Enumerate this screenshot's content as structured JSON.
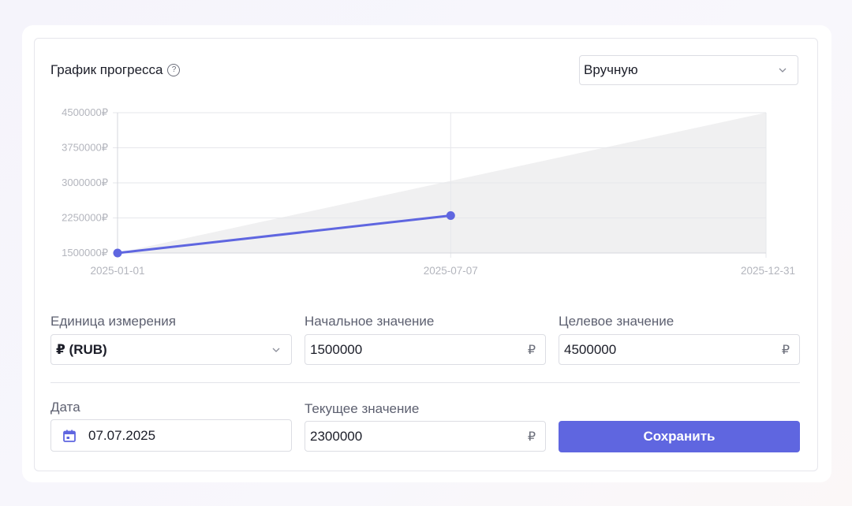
{
  "card": {
    "title": "График прогресса",
    "help_symbol": "?",
    "mode_select": {
      "value": "Вручную"
    }
  },
  "chart_data": {
    "type": "line",
    "x": [
      "2025-01-01",
      "2025-07-07"
    ],
    "series": [
      {
        "values": [
          1500000,
          2300000
        ]
      }
    ],
    "target_band": {
      "x": [
        "2025-01-01",
        "2025-12-31"
      ],
      "values": [
        1500000,
        4500000
      ]
    },
    "x_ticks": [
      "2025-01-01",
      "2025-07-07",
      "2025-12-31"
    ],
    "y_ticks": [
      "4500000₽",
      "3750000₽",
      "3000000₽",
      "2250000₽",
      "1500000₽"
    ],
    "ylim": [
      1500000,
      4500000
    ],
    "xlim": [
      "2025-01-01",
      "2025-12-31"
    ],
    "grid": true,
    "colors": {
      "line": "#5f66e0",
      "area": "#f0f0f1",
      "grid": "#e6e7eb"
    }
  },
  "form": {
    "unit": {
      "label": "Единица измерения",
      "value": "₽ (RUB)"
    },
    "start": {
      "label": "Начальное значение",
      "value": "1500000",
      "suffix": "₽"
    },
    "target": {
      "label": "Целевое значение",
      "value": "4500000",
      "suffix": "₽"
    },
    "date": {
      "label": "Дата",
      "value": "07.07.2025"
    },
    "current": {
      "label": "Текущее значение",
      "value": "2300000",
      "suffix": "₽"
    },
    "save_label": "Сохранить"
  },
  "colors": {
    "accent": "#5f66e0"
  }
}
